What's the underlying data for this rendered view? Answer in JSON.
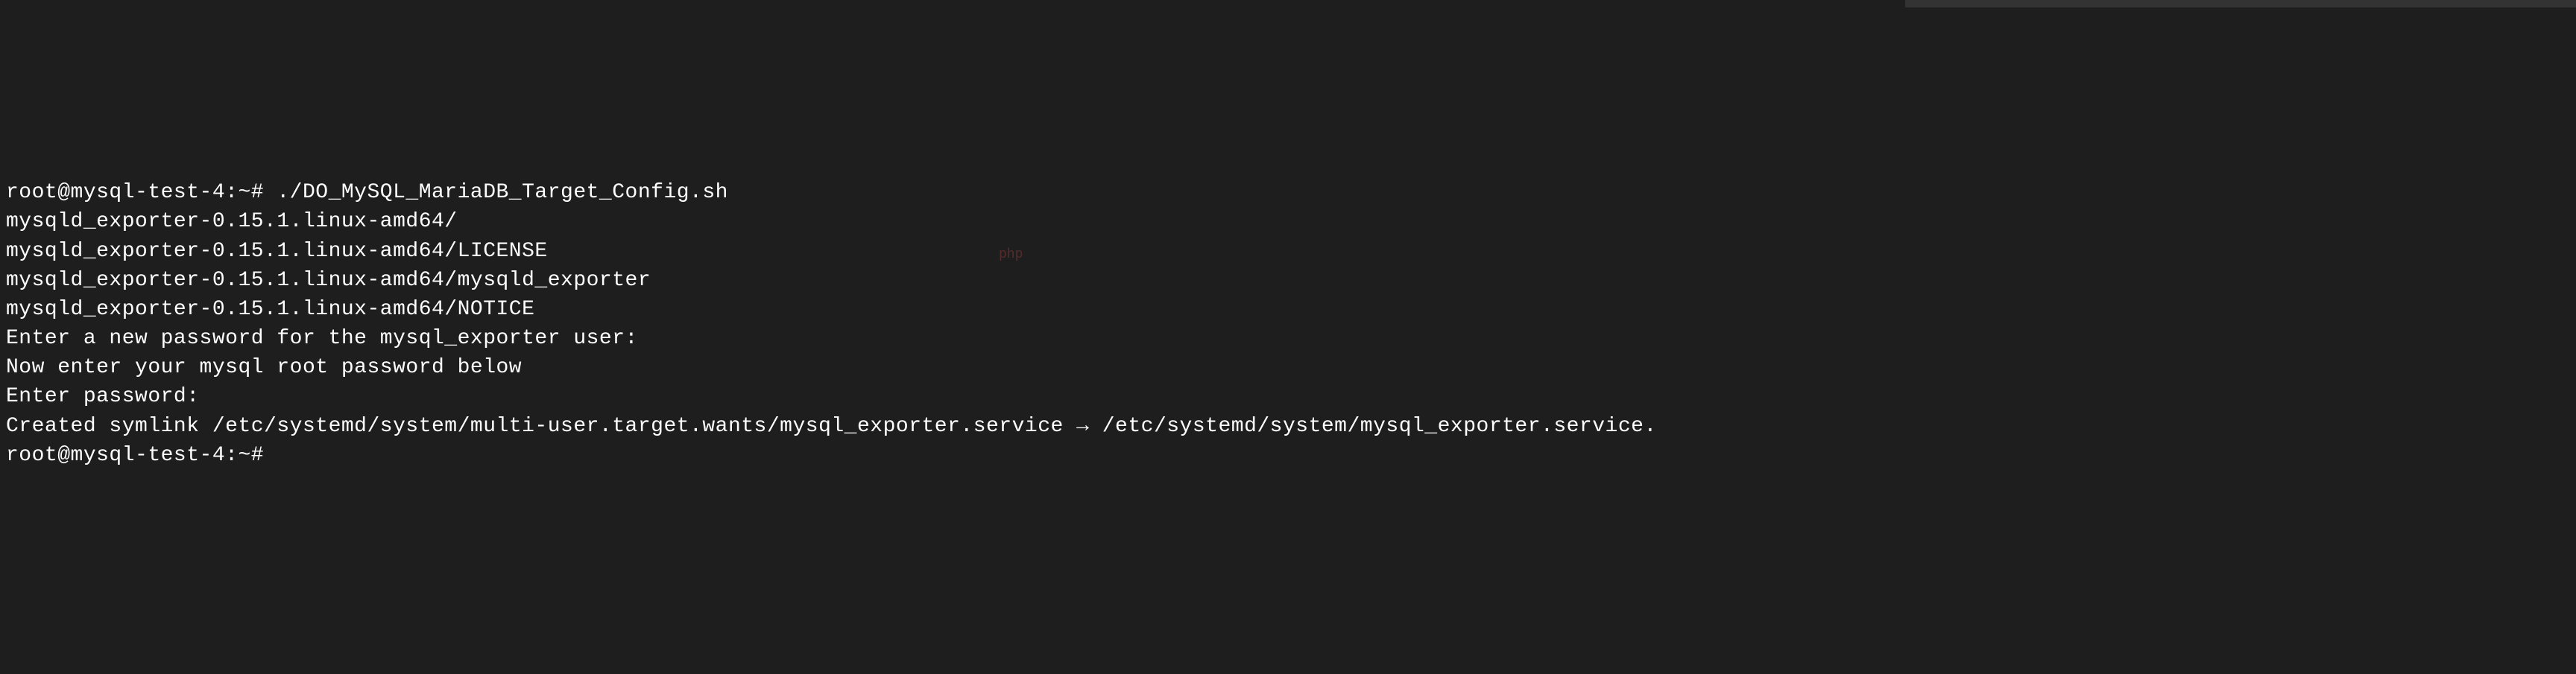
{
  "terminal": {
    "lines": [
      {
        "prompt": "root@mysql-test-4:~# ",
        "command": "./DO_MySQL_MariaDB_Target_Config.sh"
      },
      {
        "output": "mysqld_exporter-0.15.1.linux-amd64/"
      },
      {
        "output": "mysqld_exporter-0.15.1.linux-amd64/LICENSE"
      },
      {
        "output": "mysqld_exporter-0.15.1.linux-amd64/mysqld_exporter"
      },
      {
        "output": "mysqld_exporter-0.15.1.linux-amd64/NOTICE"
      },
      {
        "output": "Enter a new password for the mysql_exporter user:"
      },
      {
        "output": "Now enter your mysql root password below"
      },
      {
        "output": "Enter password:"
      },
      {
        "output": "Created symlink /etc/systemd/system/multi-user.target.wants/mysql_exporter.service → /etc/systemd/system/mysql_exporter.service."
      },
      {
        "prompt": "root@mysql-test-4:~# ",
        "command": ""
      }
    ]
  },
  "watermark": "php"
}
